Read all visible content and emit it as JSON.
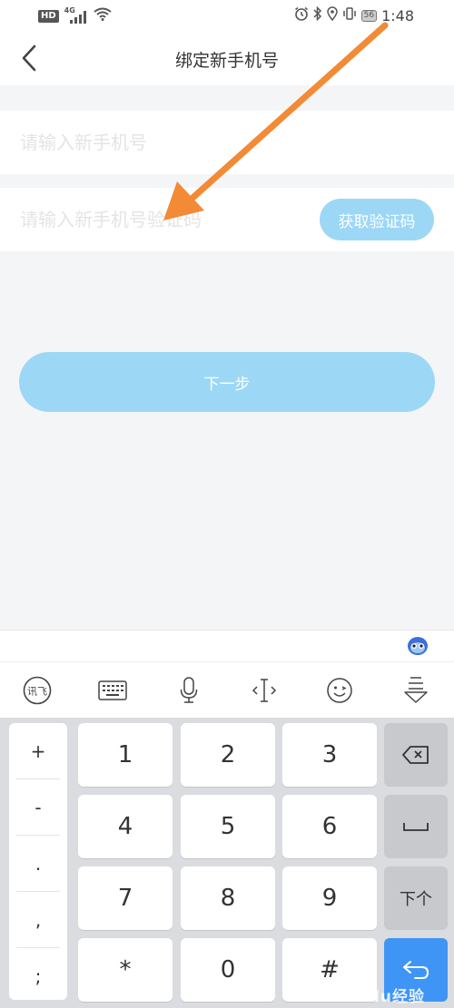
{
  "status_bar": {
    "hd_label": "HD",
    "network_label": "4G",
    "battery_level": "56",
    "time": "1:48"
  },
  "header": {
    "title": "绑定新手机号"
  },
  "form": {
    "phone_placeholder": "请输入新手机号",
    "code_placeholder": "请输入新手机号验证码",
    "get_code_label": "获取验证码",
    "next_label": "下一步"
  },
  "keyboard": {
    "symbols": [
      "+",
      "-",
      ".",
      ",",
      ";"
    ],
    "keys": [
      "1",
      "2",
      "3",
      "4",
      "5",
      "6",
      "7",
      "8",
      "9",
      "*",
      "0",
      "#"
    ],
    "next_field_label": "下个",
    "xunfei_label": "讯飞"
  },
  "watermark": "Baidu经验",
  "colors": {
    "accent_button": "#9dd7f6",
    "enter_key": "#3f95f5",
    "annotation_arrow": "#f28a36"
  },
  "icons": [
    "back-chevron-icon",
    "keyboard-icon",
    "microphone-icon",
    "cursor-icon",
    "emoji-icon",
    "collapse-keyboard-icon",
    "backspace-icon",
    "space-icon",
    "enter-icon"
  ]
}
